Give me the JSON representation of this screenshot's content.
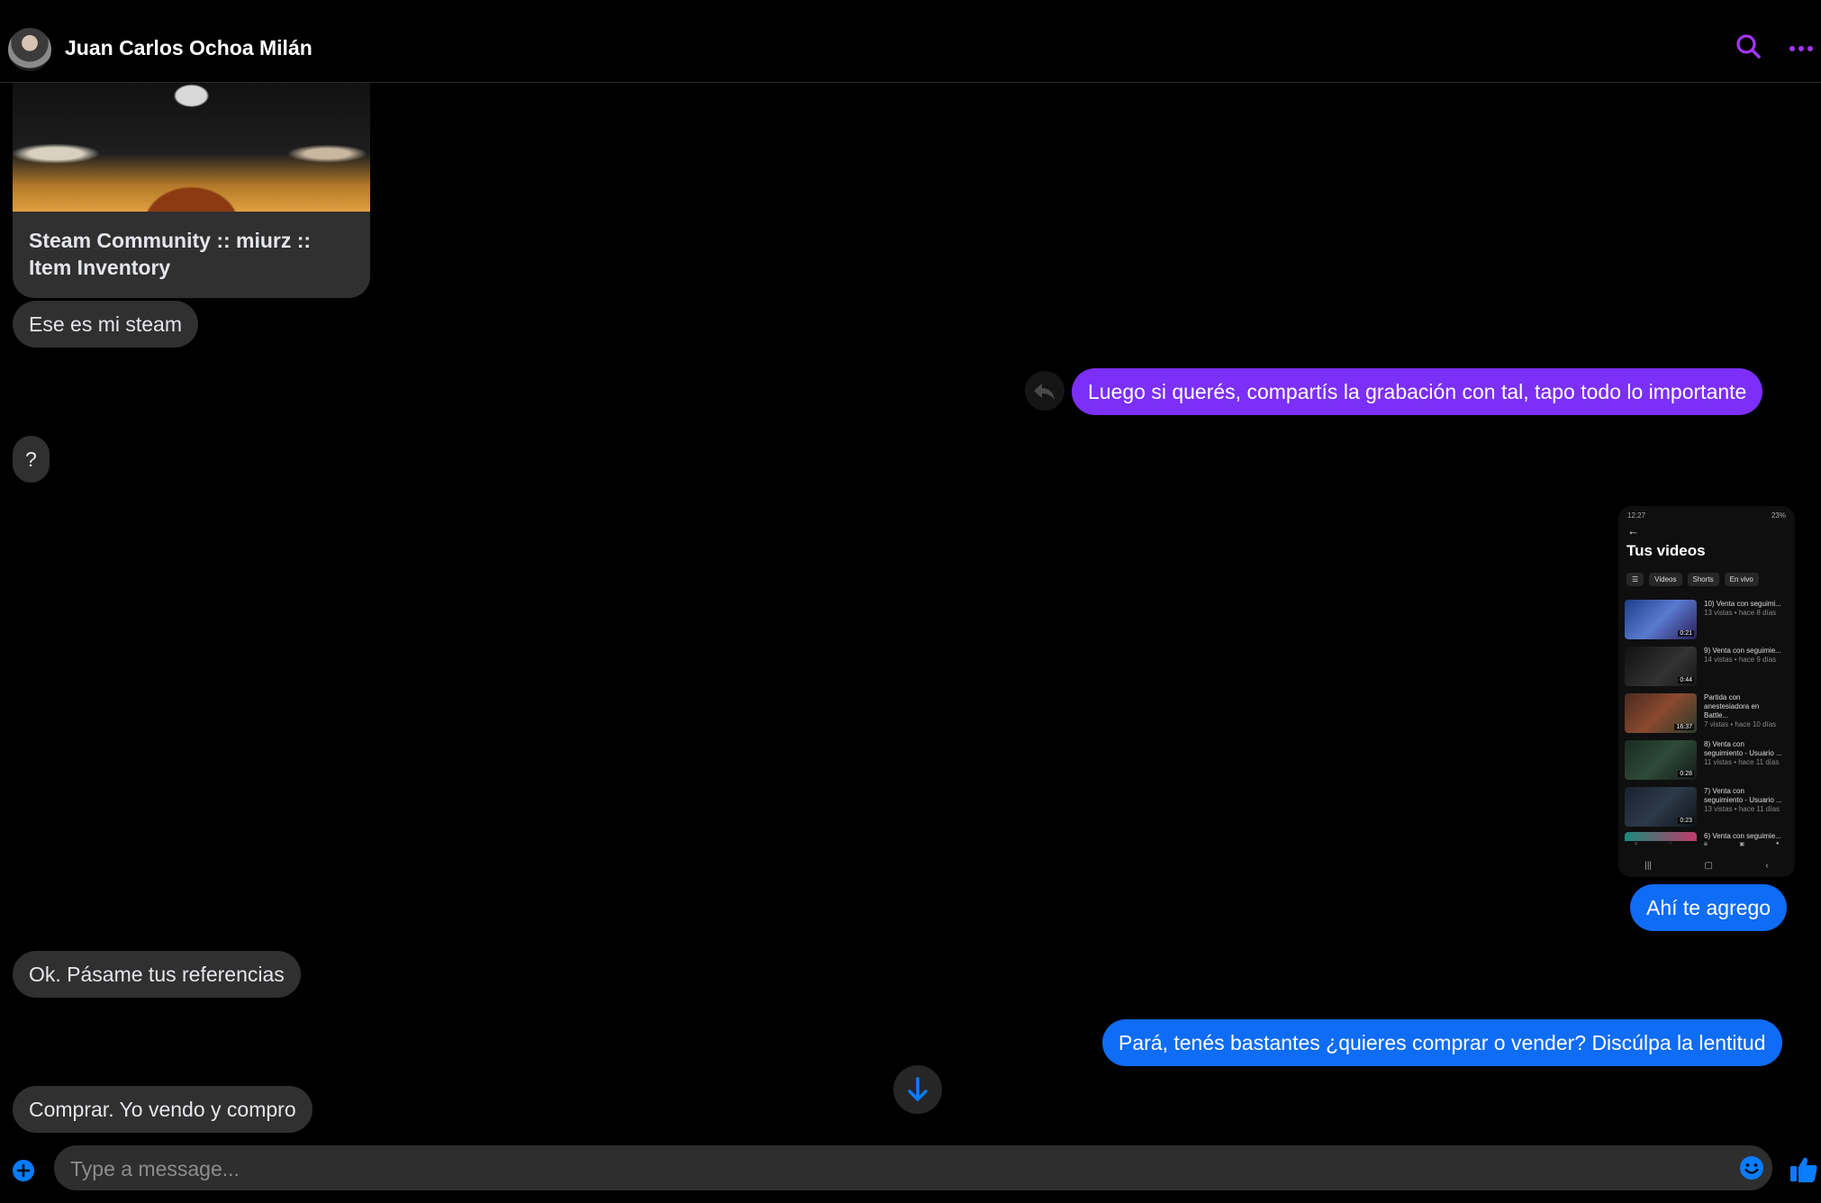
{
  "header": {
    "contact_name": "Juan Carlos Ochoa Milán",
    "avatar_icon": "contact-avatar",
    "search_icon": "search-icon",
    "more_icon": "more-options-icon",
    "accent": "#a335f5"
  },
  "messages": {
    "link_card_title": "Steam Community :: miurz :: Item Inventory",
    "m1": "Ese es mi steam",
    "m2": "Luego si querés, compartís la grabación con tal, tapo todo lo importante",
    "m3": "?",
    "m4": "Ahí te agrego",
    "m5": "Ok. Pásame tus referencias",
    "m6": "Pará, tenés bastantes ¿quieres comprar o vender? Discúlpa la lentitud",
    "m7": "Comprar. Yo vendo y compro"
  },
  "shared_screenshot": {
    "status_left": "12:27",
    "status_right": "23%",
    "title": "Tus videos",
    "chips": [
      "Videos",
      "Shorts",
      "En vivo"
    ],
    "videos": [
      {
        "title": "10) Venta con seguimi...",
        "meta": "13 vistas • hace 8 días",
        "duration": "0:21"
      },
      {
        "title": "9) Venta con seguimie...",
        "meta": "14 vistas • hace 9 días",
        "duration": "0:44"
      },
      {
        "title": "Partida con anestesiadora en Battle...",
        "meta": "7 vistas • hace 10 días",
        "duration": "16:37"
      },
      {
        "title": "8) Venta con seguimiento - Usuario ...",
        "meta": "11 vistas • hace 11 días",
        "duration": "0:28"
      },
      {
        "title": "7) Venta con seguimiento - Usuario ...",
        "meta": "13 vistas • hace 11 días",
        "duration": "0:23"
      },
      {
        "title": "6) Venta con seguimie...",
        "meta": "",
        "duration": ""
      }
    ]
  },
  "composer": {
    "placeholder": "Type a message...",
    "plus_icon": "add-circle-icon",
    "emoji_icon": "emoji-icon",
    "like_icon": "thumbs-up-icon",
    "accent": "#0a7cff"
  },
  "colors": {
    "incoming_bubble": "#303030",
    "outgoing_purple": "#7b2ff7",
    "outgoing_blue": "#0f6cf5"
  }
}
